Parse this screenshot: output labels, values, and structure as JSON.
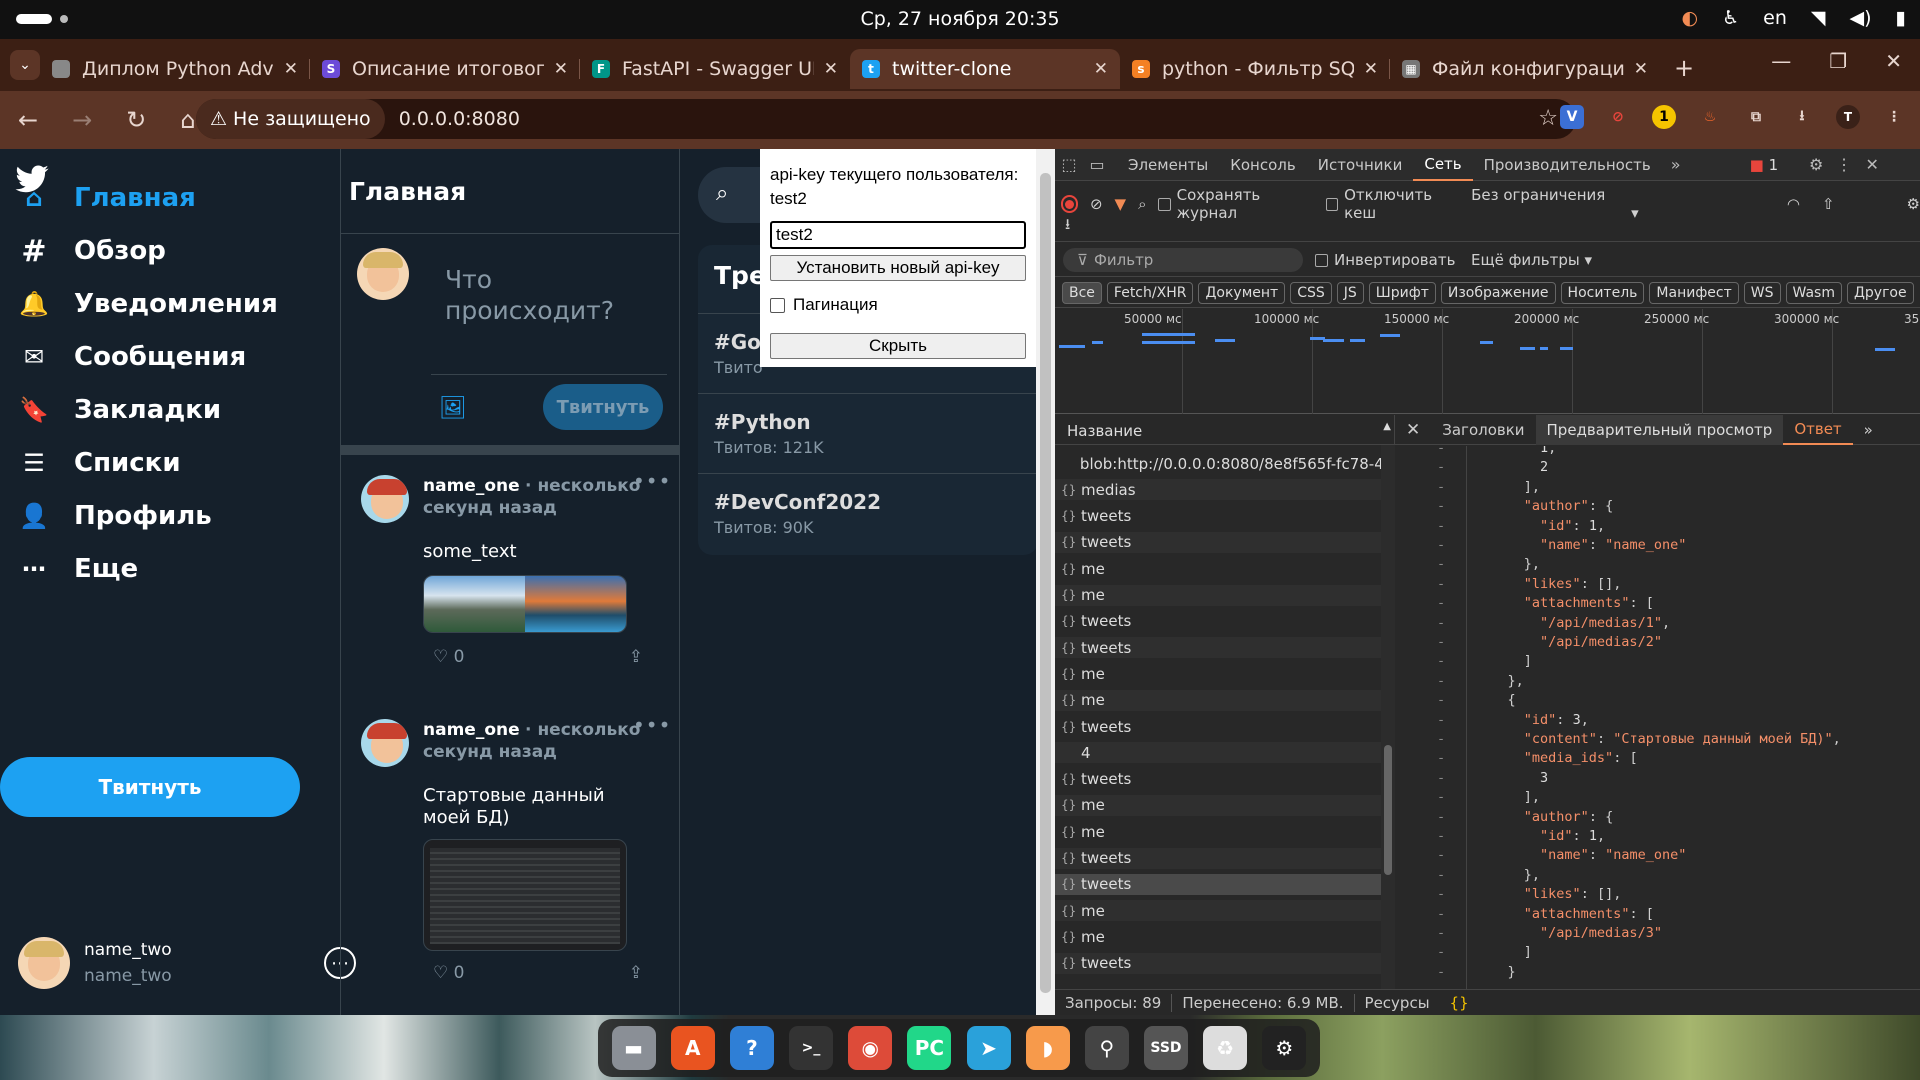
{
  "system": {
    "clock": "Ср, 27 ноября  20:35",
    "lang": "en"
  },
  "browser": {
    "tabs": [
      {
        "title": "Диплом Python Adva",
        "fav_color": "#888888",
        "fav_glyph": ""
      },
      {
        "title": "Описание итогового",
        "fav_color": "#6c4bd8",
        "fav_glyph": "S"
      },
      {
        "title": "FastAPI - Swagger UI",
        "fav_color": "#009688",
        "fav_glyph": "F"
      },
      {
        "title": "twitter-clone",
        "fav_color": "#1da1f2",
        "fav_glyph": "t"
      },
      {
        "title": "python - Фильтр SQL",
        "fav_color": "#f48024",
        "fav_glyph": "s"
      },
      {
        "title": "Файл конфигурации",
        "fav_color": "#777777",
        "fav_glyph": "▦"
      }
    ],
    "insecure_label": "Не защищено",
    "url": "0.0.0.0:8080",
    "profile_letter": "T"
  },
  "sidebar": {
    "items": [
      {
        "label": "Главная",
        "icon": "home-icon"
      },
      {
        "label": "Обзор",
        "icon": "hashtag-icon"
      },
      {
        "label": "Уведомления",
        "icon": "bell-icon"
      },
      {
        "label": "Сообщения",
        "icon": "mail-icon"
      },
      {
        "label": "Закладки",
        "icon": "bookmark-icon"
      },
      {
        "label": "Списки",
        "icon": "list-icon"
      },
      {
        "label": "Профиль",
        "icon": "profile-icon"
      },
      {
        "label": "Еще",
        "icon": "more-icon"
      }
    ],
    "tweet_button": "Твитнуть",
    "user": {
      "name": "name_two",
      "handle": "name_two"
    }
  },
  "feed": {
    "title": "Главная",
    "compose_placeholder": "Что происходит?",
    "compose_button": "Твитнуть",
    "posts": [
      {
        "author": "name_one",
        "meta": "несколько секунд назад",
        "text": "some_text",
        "likes": "0"
      },
      {
        "author": "name_one",
        "meta": "несколько секунд назад",
        "text": "Стартовые данный моей БД)",
        "likes": "0"
      }
    ]
  },
  "trends": {
    "title": "Тре",
    "items": [
      {
        "name": "#Gol",
        "count": "Твито"
      },
      {
        "name": "#Python",
        "count": "Твитов: 121K"
      },
      {
        "name": "#DevConf2022",
        "count": "Твитов: 90K"
      }
    ]
  },
  "popup": {
    "label": "api-key текущего пользователя:",
    "current_key": "test2",
    "input_value": "test2",
    "set_button": "Установить новый api-key",
    "pagination_label": "Пагинация",
    "hide_button": "Скрыть"
  },
  "devtools": {
    "tabs": [
      "Элементы",
      "Консоль",
      "Источники",
      "Сеть",
      "Производительность"
    ],
    "issues": "1",
    "preserve_log": "Сохранять журнал",
    "disable_cache": "Отключить кеш",
    "throttle": "Без ограничения",
    "filter_placeholder": "Фильтр",
    "invert": "Инвертировать",
    "more_filters": "Ещё фильтры",
    "types": [
      "Все",
      "Fetch/XHR",
      "Документ",
      "CSS",
      "JS",
      "Шрифт",
      "Изображение",
      "Носитель",
      "Манифест",
      "WS",
      "Wasm",
      "Другое"
    ],
    "timeline_labels": [
      "50000 мс",
      "100000 мс",
      "150000 мс",
      "200000 мс",
      "250000 мс",
      "300000 мс",
      "35"
    ],
    "list_header": "Название",
    "requests": [
      "blob:http://0.0.0.0:8080/8e8f565f-fc78-4...",
      "medias",
      "tweets",
      "tweets",
      "me",
      "me",
      "tweets",
      "tweets",
      "me",
      "me",
      "tweets",
      "4",
      "tweets",
      "me",
      "me",
      "tweets",
      "tweets",
      "me",
      "me",
      "tweets"
    ],
    "detail_tabs": [
      "Заголовки",
      "Предварительный просмотр",
      "Ответ"
    ],
    "response_lines": [
      "        1,",
      "        2",
      "      ],",
      "      \"author\": {",
      "        \"id\": 1,",
      "        \"name\": \"name_one\"",
      "      },",
      "      \"likes\": [],",
      "      \"attachments\": [",
      "        \"/api/medias/1\",",
      "        \"/api/medias/2\"",
      "      ]",
      "    },",
      "    {",
      "      \"id\": 3,",
      "      \"content\": \"Стартовые данный моей БД)\",",
      "      \"media_ids\": [",
      "        3",
      "      ],",
      "      \"author\": {",
      "        \"id\": 1,",
      "        \"name\": \"name_one\"",
      "      },",
      "      \"likes\": [],",
      "      \"attachments\": [",
      "        \"/api/medias/3\"",
      "      ]",
      "    }"
    ],
    "status": {
      "requests": "Запросы: 89",
      "transferred": "Перенесено: 6.9 MB.",
      "resources": "Ресурсы"
    }
  },
  "dock": {
    "apps": [
      {
        "icon": "files-icon",
        "color": "#8a8f96",
        "glyph": "▬"
      },
      {
        "icon": "app-center-icon",
        "color": "#e95420",
        "glyph": "A"
      },
      {
        "icon": "help-icon",
        "color": "#2f7fd6",
        "glyph": "?"
      },
      {
        "icon": "terminal-icon",
        "color": "#333333",
        "glyph": ">_"
      },
      {
        "icon": "chrome-icon",
        "color": "#dd4b39",
        "glyph": "◉"
      },
      {
        "icon": "pycharm-icon",
        "color": "#21d789",
        "glyph": "PC"
      },
      {
        "icon": "telegram-icon",
        "color": "#2aa1da",
        "glyph": "➤"
      },
      {
        "icon": "mango-icon",
        "color": "#f79a4b",
        "glyph": "◗"
      },
      {
        "icon": "usb-icon",
        "color": "#444444",
        "glyph": "⚲"
      },
      {
        "icon": "ssd-icon",
        "color": "#555555",
        "glyph": "SSD"
      },
      {
        "icon": "trash-icon",
        "color": "#dddddd",
        "glyph": "♻"
      },
      {
        "icon": "settings-icon",
        "color": "#222222",
        "glyph": "⚙"
      }
    ]
  }
}
